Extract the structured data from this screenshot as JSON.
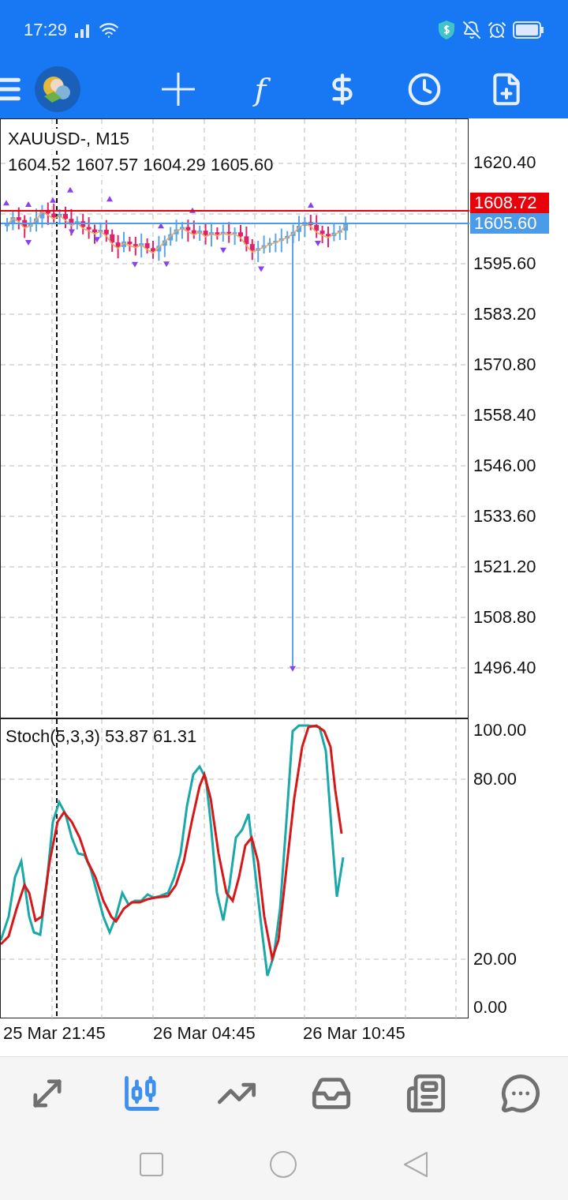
{
  "status_bar": {
    "time": "17:29"
  },
  "toolbar": {
    "function_glyph": "f"
  },
  "chart": {
    "symbol": "XAUUSD-, M15",
    "ohlc": "1604.52 1607.57 1604.29 1605.60",
    "price_axis": [
      "1620.40",
      "1595.60",
      "1583.20",
      "1570.80",
      "1558.40",
      "1546.00",
      "1533.60",
      "1521.20",
      "1508.80",
      "1496.40"
    ],
    "price_lines": [
      {
        "label": "1608.72",
        "color": "#e8000b"
      },
      {
        "label": "1605.60",
        "color": "#4a9be8"
      }
    ],
    "indicator": {
      "label": "Stoch(5,3,3) 53.87 61.31",
      "axis": [
        "100.00",
        "80.00",
        "20.00",
        "0.00"
      ]
    },
    "time_axis": [
      "25 Mar 21:45",
      "26 Mar 04:45",
      "26 Mar 10:45"
    ]
  },
  "bottom_nav": [
    {
      "kind": "trade",
      "selected": false
    },
    {
      "kind": "chart",
      "selected": true
    },
    {
      "kind": "trend",
      "selected": false
    },
    {
      "kind": "inbox",
      "selected": false
    },
    {
      "kind": "news",
      "selected": false
    },
    {
      "kind": "chat",
      "selected": false
    }
  ]
}
